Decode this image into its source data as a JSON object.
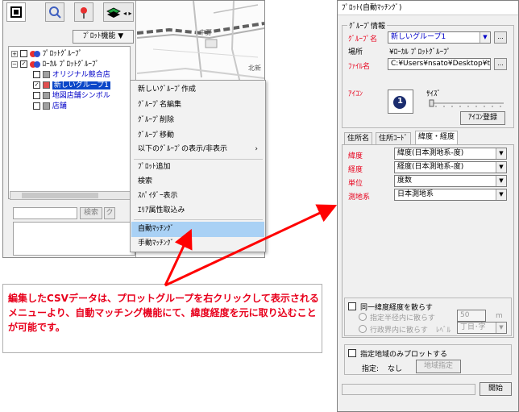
{
  "left_app": {
    "toolbar": {
      "icons": [
        "home-icon",
        "search-icon",
        "pin-icon",
        "layers-icon"
      ],
      "plot_func_label": "ﾌﾟﾛｯﾄ機能 ▼"
    },
    "tree": {
      "items": [
        {
          "text": "ﾌﾟﾛｯﾄｸﾞﾙｰﾌﾟ",
          "expander": "+"
        },
        {
          "text": "ﾛｰｶﾙ ﾌﾟﾛｯﾄｸﾞﾙｰﾌﾟ",
          "expander": "−"
        },
        {
          "text": "オリジナル競合店"
        },
        {
          "text": "新しいグループ1"
        },
        {
          "text": "地図店舗シンボル"
        },
        {
          "text": "店舗"
        }
      ]
    },
    "search_button": "検索",
    "search_button_2": "ク"
  },
  "map": {
    "labels": [
      "中野",
      "北新"
    ]
  },
  "context_menu": {
    "items": [
      "新しいｸﾞﾙｰﾌﾟ作成",
      "ｸﾞﾙｰﾌﾟ名編集",
      "ｸﾞﾙｰﾌﾟ削除",
      "ｸﾞﾙｰﾌﾟ移動",
      "以下のｸﾞﾙｰﾌﾟの表示/非表示",
      "ﾌﾟﾛｯﾄ追加",
      "検索",
      "ｽﾊﾟｲﾀﾞｰ表示",
      "ｴﾘｱ属性取込み",
      "自動ﾏｯﾁﾝｸﾞ",
      "手動ﾏｯﾁﾝｸﾞ"
    ],
    "submenu_arrow": "›"
  },
  "annotation": {
    "text": "編集したCSVデータは、プロットグループを右クリックして表示されるメニューより、自動マッチング機能にて、緯度経度を元に取り込むことが可能です。"
  },
  "dialog": {
    "title": "ﾌﾟﾛｯﾄ(自動ﾏｯﾁﾝｸﾞ)",
    "group_info": {
      "title": "ｸﾞﾙｰﾌﾟ情報",
      "group_name_label": "ｸﾞﾙｰﾌﾟ名",
      "group_name_value": "新しいグループ1",
      "location_label": "場所",
      "location_value": "¥ﾛｰｶﾙ ﾌﾟﾛｯﾄｸﾞﾙｰﾌﾟ",
      "file_label": "ﾌｧｲﾙ名",
      "file_value": "C:¥Users¥nsato¥Desktop¥tes",
      "icon_label": "ｱｲｺﾝ",
      "icon_number": "1",
      "size_label": "ｻｲｽﾞ",
      "icon_register_button": "ｱｲｺﾝ登録",
      "browse": "..."
    },
    "tabs": [
      "住所名",
      "住所ｺｰﾄﾞ",
      "緯度・経度"
    ],
    "fields": [
      {
        "label": "緯度",
        "value": "緯度(日本測地系-度)"
      },
      {
        "label": "経度",
        "value": "経度(日本測地系-度)"
      },
      {
        "label": "単位",
        "value": "度数"
      },
      {
        "label": "測地系",
        "value": "日本測地系"
      }
    ],
    "dispersion": {
      "checkbox_label": "同一緯度経度を散らす",
      "radius_label": "指定半径内に散らす",
      "radius_value": "50",
      "radius_unit": "m",
      "admin_label": "行政界内に散らす",
      "level_label": "ﾚﾍﾞﾙ",
      "level_value": "丁目･字"
    },
    "region": {
      "checkbox_label": "指定地域のみプロットする",
      "specify_label": "指定:",
      "specify_value": "なし",
      "region_button": "地域指定"
    },
    "start_button": "開始"
  },
  "colors": {
    "annotation_red": "#e8001c",
    "arrow_red": "#ff0000",
    "selection_blue": "#0a46c8",
    "menu_highlight": "#a9d1f5"
  }
}
